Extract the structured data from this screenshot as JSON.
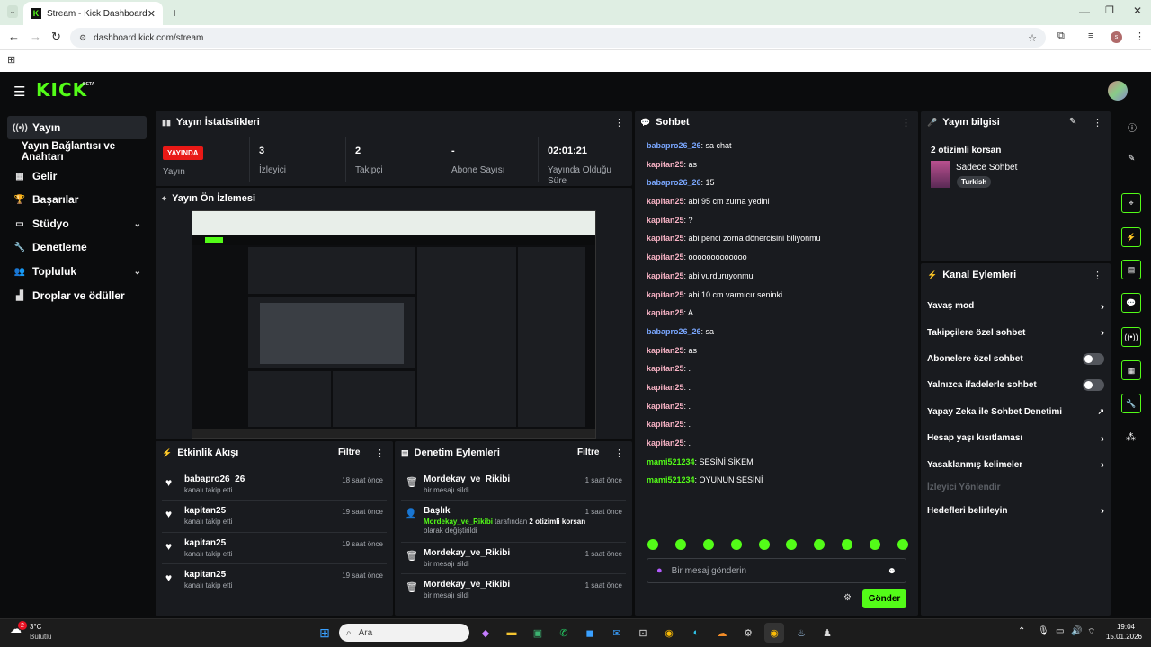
{
  "browser": {
    "tab_title": "Stream - Kick Dashboard",
    "url": "dashboard.kick.com/stream",
    "profile_initial": "s"
  },
  "kick": {
    "logo": "KICK",
    "beta": "BETA"
  },
  "sidebar": {
    "items": [
      {
        "label": "Yayın",
        "icon": "broadcast-icon"
      },
      {
        "label": "Yayın Bağlantısı ve Anahtarı",
        "icon": ""
      },
      {
        "label": "Gelir",
        "icon": "revenue-icon"
      },
      {
        "label": "Başarılar",
        "icon": "trophy-icon"
      },
      {
        "label": "Stüdyo",
        "icon": "studio-icon"
      },
      {
        "label": "Denetleme",
        "icon": "wrench-icon"
      },
      {
        "label": "Topluluk",
        "icon": "community-icon"
      },
      {
        "label": "Droplar ve ödüller",
        "icon": "gift-icon"
      }
    ]
  },
  "stats": {
    "title": "Yayın İstatistikleri",
    "live_badge": "YAYINDA",
    "live_label": "Yayın",
    "viewers_value": "3",
    "viewers_label": "İzleyici",
    "followers_value": "2",
    "followers_label": "Takipçi",
    "subs_value": "-",
    "subs_label": "Abone Sayısı",
    "uptime_value": "02:01:21",
    "uptime_label": "Yayında Olduğu Süre"
  },
  "preview": {
    "title": "Yayın Ön İzlemesi"
  },
  "activity": {
    "title": "Etkinlik Akışı",
    "filter": "Filtre",
    "rows": [
      {
        "name": "babapro26_26",
        "sub": "kanalı takip etti",
        "time": "18 saat önce"
      },
      {
        "name": "kapitan25",
        "sub": "kanalı takip etti",
        "time": "19 saat önce"
      },
      {
        "name": "kapitan25",
        "sub": "kanalı takip etti",
        "time": "19 saat önce"
      },
      {
        "name": "kapitan25",
        "sub": "kanalı takip etti",
        "time": "19 saat önce"
      }
    ]
  },
  "moderation": {
    "title": "Denetim Eylemleri",
    "filter": "Filtre",
    "rows": [
      {
        "name": "Mordekay_ve_Rikibi",
        "sub": "bir mesajı sildi",
        "time": "1 saat önce"
      },
      {
        "name": "Başlık",
        "sub_user": "Mordekay_ve_Rikibi",
        "sub_mid": " tarafından ",
        "sub_title": "2 otizimli korsan",
        "sub_tail": " olarak değiştirildi",
        "time": "1 saat önce"
      },
      {
        "name": "Mordekay_ve_Rikibi",
        "sub": "bir mesajı sildi",
        "time": "1 saat önce"
      },
      {
        "name": "Mordekay_ve_Rikibi",
        "sub": "bir mesajı sildi",
        "time": "1 saat önce"
      }
    ]
  },
  "chat": {
    "title": "Sohbet",
    "placeholder": "Bir mesaj gönderin",
    "send": "Gönder",
    "messages": [
      {
        "user": "babapro26_26",
        "color": "#7aa7ff",
        "text": ": sa chat"
      },
      {
        "user": "kapitan25",
        "color": "#f7b2c4",
        "text": ": as"
      },
      {
        "user": "babapro26_26",
        "color": "#7aa7ff",
        "text": ": 15"
      },
      {
        "user": "kapitan25",
        "color": "#f7b2c4",
        "text": ": abi 95 cm zurna yedini"
      },
      {
        "user": "kapitan25",
        "color": "#f7b2c4",
        "text": ": ?"
      },
      {
        "user": "kapitan25",
        "color": "#f7b2c4",
        "text": ": abi penci zorna dönercisini biliyonmu"
      },
      {
        "user": "kapitan25",
        "color": "#f7b2c4",
        "text": ": ooooooooooooo"
      },
      {
        "user": "kapitan25",
        "color": "#f7b2c4",
        "text": ": abi vurduruyonmu"
      },
      {
        "user": "kapitan25",
        "color": "#f7b2c4",
        "text": ": abi 10 cm varmıcır seninki"
      },
      {
        "user": "kapitan25",
        "color": "#f7b2c4",
        "text": ": A"
      },
      {
        "user": "babapro26_26",
        "color": "#7aa7ff",
        "text": ": sa"
      },
      {
        "user": "kapitan25",
        "color": "#f7b2c4",
        "text": ": as"
      },
      {
        "user": "kapitan25",
        "color": "#f7b2c4",
        "text": ": ."
      },
      {
        "user": "kapitan25",
        "color": "#f7b2c4",
        "text": ": ."
      },
      {
        "user": "kapitan25",
        "color": "#f7b2c4",
        "text": ": ."
      },
      {
        "user": "kapitan25",
        "color": "#f7b2c4",
        "text": ": ."
      },
      {
        "user": "kapitan25",
        "color": "#f7b2c4",
        "text": ": ."
      },
      {
        "user": "mami521234",
        "color": "#53fc18",
        "text": ": SESİNİ SİKEM"
      },
      {
        "user": "mami521234",
        "color": "#53fc18",
        "text": ": OYUNUN SESİNİ"
      }
    ]
  },
  "stream_info": {
    "title": "Yayın bilgisi",
    "stream_title": "2 otizimli korsan",
    "category": "Sadece Sohbet",
    "language": "Turkish"
  },
  "channel_actions": {
    "title": "Kanal Eylemleri",
    "items": [
      {
        "label": "Yavaş mod",
        "control": "arrow"
      },
      {
        "label": "Takipçilere özel sohbet",
        "control": "arrow"
      },
      {
        "label": "Abonelere özel sohbet",
        "control": "toggle"
      },
      {
        "label": "Yalnızca ifadelerle sohbet",
        "control": "toggle"
      },
      {
        "label": "Yapay Zeka ile Sohbet Denetimi",
        "control": "external"
      },
      {
        "label": "Hesap yaşı kısıtlaması",
        "control": "arrow"
      },
      {
        "label": "Yasaklanmış kelimeler",
        "control": "arrow"
      },
      {
        "label": "İzleyici Yönlendir",
        "control": "disabled"
      },
      {
        "label": "Hedefleri belirleyin",
        "control": "arrow"
      }
    ]
  },
  "taskbar": {
    "weather_temp": "3°C",
    "weather_desc": "Bulutlu",
    "search_placeholder": "Ara",
    "time": "19:04",
    "date": "15.01.2026",
    "notification_count": "2"
  },
  "colors": {
    "accent": "#53fc18",
    "live": "#e91916",
    "panel": "#191b1f",
    "bg": "#0b0c0d"
  }
}
